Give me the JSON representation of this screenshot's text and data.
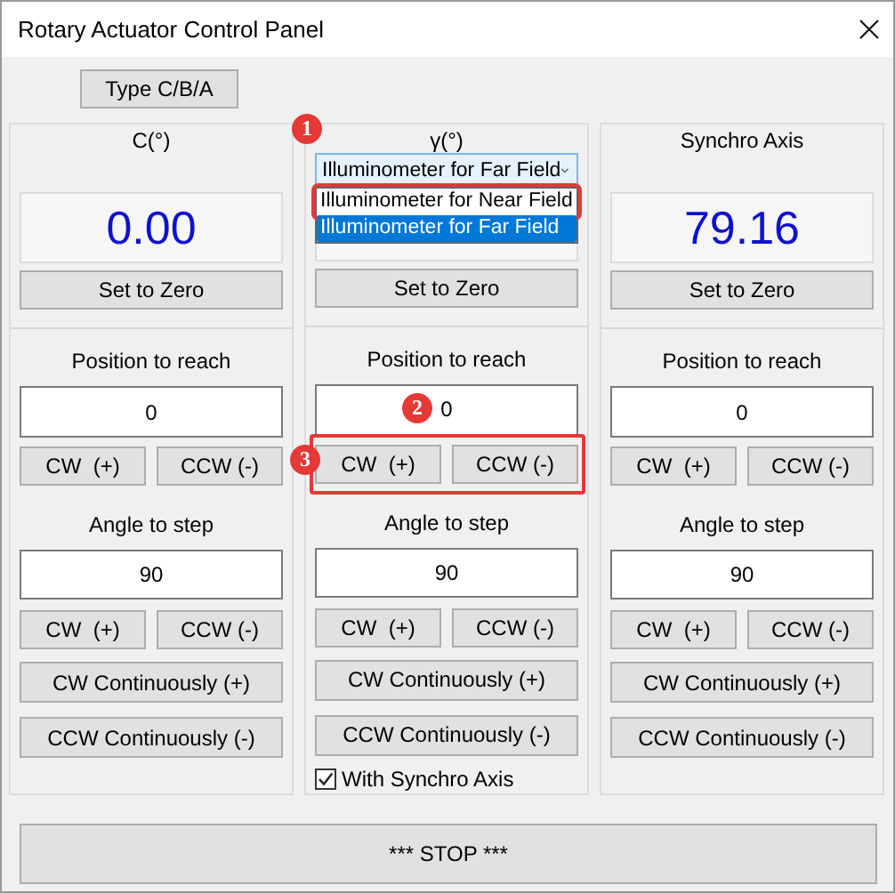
{
  "window": {
    "title": "Rotary Actuator Control Panel"
  },
  "type_button": "Type C/B/A",
  "axes": [
    {
      "kind": "plain",
      "header": "C(°)",
      "display": "0.00",
      "zero_button": "Set to Zero",
      "position_label": "Position to reach",
      "position_value": "0",
      "position_buttons": [
        "CW  (+)",
        "CCW (-)"
      ],
      "angle_label": "Angle to step",
      "angle_value": "90",
      "step_buttons": [
        "CW  (+)",
        "CCW (-)"
      ],
      "continuous_buttons": [
        "CW Continuously (+)",
        "CCW Continuously (-)"
      ]
    },
    {
      "kind": "dropdown",
      "header": "γ(°)",
      "header_badge": "1",
      "dropdown": {
        "value": "Illuminometer for Far Field",
        "expanded": true,
        "options": [
          {
            "label": "Illuminometer for Near Field",
            "selected": false,
            "outlined": true
          },
          {
            "label": "Illuminometer for Far Field",
            "selected": true,
            "outlined": false
          }
        ]
      },
      "zero_button": "Set to Zero",
      "position_label": "Position to reach",
      "position_value": "0",
      "position_badge": "2",
      "position_buttons": [
        "CW  (+)",
        "CCW (-)"
      ],
      "position_buttons_badge": "3",
      "position_buttons_outlined": true,
      "angle_label": "Angle to step",
      "angle_value": "90",
      "step_buttons": [
        "CW  (+)",
        "CCW (-)"
      ],
      "continuous_buttons": [
        "CW Continuously (+)",
        "CCW Continuously (-)"
      ],
      "checkbox": {
        "label": "With Synchro Axis",
        "checked": true
      }
    },
    {
      "kind": "plain",
      "header": "Synchro Axis",
      "display": "79.16",
      "zero_button": "Set to Zero",
      "position_label": "Position to reach",
      "position_value": "0",
      "position_buttons": [
        "CW  (+)",
        "CCW (-)"
      ],
      "angle_label": "Angle to step",
      "angle_value": "90",
      "step_buttons": [
        "CW  (+)",
        "CCW (-)"
      ],
      "continuous_buttons": [
        "CW Continuously (+)",
        "CCW Continuously (-)"
      ]
    }
  ],
  "stop_button": "*** STOP ***"
}
